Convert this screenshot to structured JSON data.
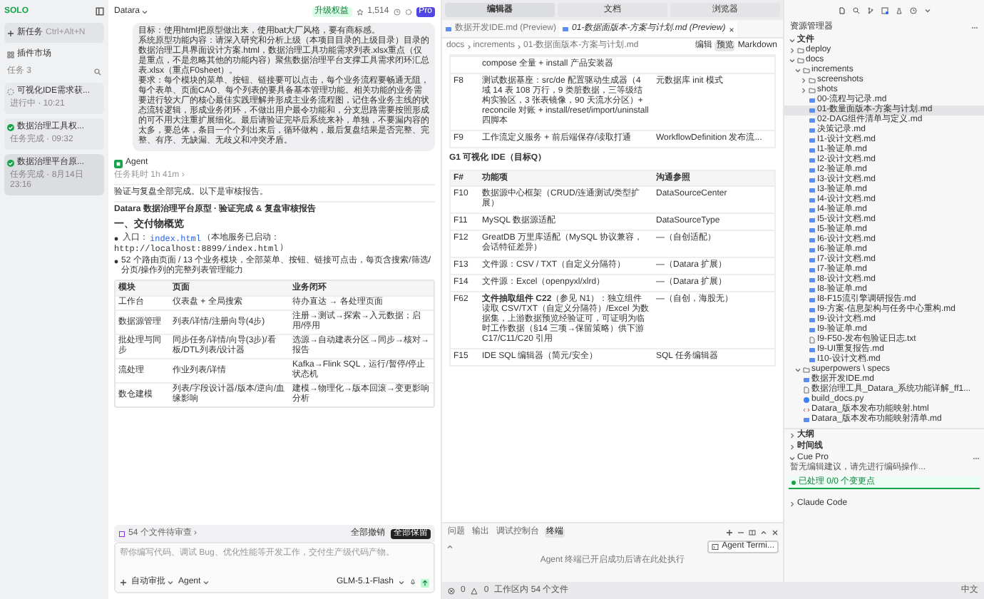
{
  "sidebar": {
    "logo": "SOLO",
    "new_task": {
      "label": "新任务",
      "shortcut": "Ctrl+Alt+N"
    },
    "plugin_market": "插件市场",
    "tasks_header": {
      "label": "任务",
      "count": "3"
    },
    "tasks": [
      {
        "title": "可视化IDE需求获...",
        "status": "进行中 · 10:21",
        "done": false,
        "selected": false
      },
      {
        "title": "数据治理工具权...",
        "status": "任务完成 · 09:32",
        "done": true,
        "selected": false
      },
      {
        "title": "数据治理平台原...",
        "status": "任务完成 · 8月14日 23:16",
        "done": true,
        "selected": true
      }
    ]
  },
  "chat": {
    "workspace": "Datara",
    "upgrade": "升级权益",
    "stars": "1,514",
    "plan": "Pro",
    "user_message": [
      "目标：使用html把原型做出来，使用bat大厂风格，要有商标感。",
      "系统原型功能内容：请深入研究和分析上级（本项目目录的上级目录）目录的数据治理工具界面设计方案.html，数据治理工具功能需求列表.xlsx重点（仅是重点，不是忽略其他的功能内容）聚焦数据治理平台支撑工具需求闭环汇总表.xlsx（重点F0sheet）。",
      "要求：每个模块的菜单、按钮、链接要可以点击，每个业务流程要畅通无阻，每个表单、页面CAO、每个列表的要具备基本管理功能。相关功能的业务需要进行较大厂的核心最佳实践理解并形成主业务流程图，记住各业务主线的状态流转逻辑，形成业务闭环，不做出用户最令功能和，分支思路需要按照形成的可不用大注重扩展细化。最后请验证完毕后系统来补，单独，不要漏内容的太多，要总体，条目一个个列出来后，循环做构，最后复盘结果是否完整、完整、有序、无缺漏、无歧义和冲突矛盾。"
    ],
    "agent": {
      "name": "Agent",
      "duration": "任务耗时 1h 41m ›",
      "intro": "验证与复盘全部完成。以下是审核报告。",
      "report_title": "Datara 数据治理平台原型 · 验证完成 & 复盘审核报告",
      "section": "一、交付物概览",
      "entry": {
        "label": "入口：",
        "code": "index.html",
        "note": "（本地服务已启动：",
        "url": "http://localhost:8899/index.html",
        "close": "）"
      },
      "summary": "52 个路由页面 / 13 个业务模块，全部菜单、按钮、链接可点击，每页含搜索/筛选/分页/操作列的完整列表管理能力",
      "table": {
        "columns": [
          "模块",
          "页面",
          "业务闭环"
        ],
        "rows": [
          [
            "工作台",
            "仪表盘 + 全局搜索",
            "待办直达 → 各处理页面"
          ],
          [
            "数据源管理",
            "列表/详情/注册向导(4步)",
            "注册→测试→探索→入元数据；启用/停用"
          ],
          [
            "批处理与同步",
            "同步任务/详情/向导(3步)/看板/DTL列表/设计器",
            "选源→自动建表分区→同步→核对→报告"
          ],
          [
            "流处理",
            "作业列表/详情",
            "Kafka→Flink SQL，运行/暂停/停止状态机"
          ],
          [
            "数仓建模",
            "列表/字段设计器/版本/逆向/血缘影响",
            "建模→物理化→版本回滚→变更影响分析"
          ]
        ]
      }
    },
    "review": {
      "label": "54 个文件待审查 ›",
      "reject": "全部撤销",
      "accept": "全部保留"
    },
    "composer": {
      "placeholder": "帮你编写代码、调试 Bug、优化性能等开发工作，交付生产级代码产物。",
      "approve": "自动审批",
      "mode": "Agent",
      "model": "GLM-5.1-Flash"
    }
  },
  "editor": {
    "top_tabs": [
      {
        "label": "编辑器",
        "selected": true
      },
      {
        "label": "文档",
        "selected": false
      },
      {
        "label": "浏览器",
        "selected": false
      }
    ],
    "file_tabs": [
      {
        "label": "数据开发IDE.md (Preview)",
        "selected": false
      },
      {
        "label": "01-数据面版本-方案与计划.md (Preview)",
        "selected": true
      }
    ],
    "breadcrumb": [
      "docs",
      "increments",
      "01-数据面版本-方案与计划.md"
    ],
    "view_buttons": [
      {
        "label": "编辑",
        "selected": false
      },
      {
        "label": "预览",
        "selected": true
      },
      {
        "label": "Markdown",
        "selected": false
      }
    ],
    "table1_rows": [
      [
        "",
        "compose 全量 + install 产品安装器",
        ""
      ],
      [
        "F8",
        "测试数据基座：src/de 配置驱动生成器（4 域 14 表 108 万行，9 类脏数据，三等级结构实验区，3 张表镜像，90 天流水分区）+ reconcile 对账 + install/reset/import/uninstall 四脚本",
        "元数据库 init 模式"
      ],
      [
        "F9",
        "工作流定义服务 + 前后端保存/读取打通",
        "WorkflowDefinition 发布流..."
      ]
    ],
    "heading": "G1 可视化 IDE（目标Q）",
    "table2": {
      "columns": [
        "F#",
        "功能项",
        "沟通参照"
      ],
      "rows": [
        [
          "F10",
          "数据源中心框架（CRUD/连通测试/类型扩展）",
          "DataSourceCenter"
        ],
        [
          "F11",
          "MySQL 数据源适配",
          "DataSourceType"
        ],
        [
          "F12",
          "GreatDB 万里库适配（MySQL 协议兼容，会话特征差异）",
          "—（自创适配）"
        ],
        [
          "F13",
          "文件源：CSV / TXT（自定义分隔符）",
          "—（Datara 扩展）"
        ],
        [
          "F14",
          "文件源：Excel（openpyxl/xlrd）",
          "—（Datara 扩展）"
        ],
        [
          "F62",
          "**文件抽取组件 C22**（参见 N1）：独立组件读取 CSV/TXT（自定义分隔符）/Excel 为数据集，上游数据预览经验证可，可证明为临时工作数据（§14 三项→保留策略）供下游 C17/C11/C20 引用",
          "—（自创，海股无）"
        ],
        [
          "F15",
          "IDE SQL 编辑器（简元/安全）",
          "SQL 任务编辑器"
        ]
      ]
    },
    "panel": {
      "tabs": [
        {
          "label": "问题",
          "selected": false
        },
        {
          "label": "输出",
          "selected": false
        },
        {
          "label": "调试控制台",
          "selected": false
        },
        {
          "label": "终端",
          "selected": true
        }
      ],
      "notice": "Agent 终端已开启成功后请在此处执行",
      "terminal_button": "Agent Termi..."
    }
  },
  "status_bar": {
    "errors": "0",
    "warnings": "0",
    "files": "工作区内 54 个文件",
    "language": "中文"
  },
  "explorer": {
    "title": "资源管理器",
    "section": "文件",
    "tree": [
      {
        "label": "deploy",
        "kind": "folder",
        "expanded": false,
        "selected": false
      },
      {
        "label": "docs",
        "kind": "folder",
        "expanded": true,
        "selected": false,
        "children": [
          {
            "label": "increments",
            "kind": "folder",
            "expanded": true,
            "selected": false,
            "children": [
              {
                "label": "screenshots",
                "kind": "folder",
                "expanded": false,
                "selected": false
              },
              {
                "label": "shots",
                "kind": "folder",
                "expanded": false,
                "selected": false
              },
              {
                "label": "00-流程与记录.md",
                "kind": "md",
                "selected": false
              },
              {
                "label": "01-数量面版本-方案与计划.md",
                "kind": "md",
                "selected": true
              },
              {
                "label": "02-DAG组件清单与定义.md",
                "kind": "md",
                "selected": false
              },
              {
                "label": "决策记录.md",
                "kind": "md",
                "selected": false
              },
              {
                "label": "I1-设计文档.md",
                "kind": "md",
                "selected": false
              },
              {
                "label": "I1-验证单.md",
                "kind": "md",
                "selected": false
              },
              {
                "label": "I2-设计文档.md",
                "kind": "md",
                "selected": false
              },
              {
                "label": "I2-验证单.md",
                "kind": "md",
                "selected": false
              },
              {
                "label": "I3-设计文档.md",
                "kind": "md",
                "selected": false
              },
              {
                "label": "I3-验证单.md",
                "kind": "md",
                "selected": false
              },
              {
                "label": "I4-设计文档.md",
                "kind": "md",
                "selected": false
              },
              {
                "label": "I4-验证单.md",
                "kind": "md",
                "selected": false
              },
              {
                "label": "I5-设计文档.md",
                "kind": "md",
                "selected": false
              },
              {
                "label": "I5-验证单.md",
                "kind": "md",
                "selected": false
              },
              {
                "label": "I6-设计文档.md",
                "kind": "md",
                "selected": false
              },
              {
                "label": "I6-验证单.md",
                "kind": "md",
                "selected": false
              },
              {
                "label": "I7-设计文档.md",
                "kind": "md",
                "selected": false
              },
              {
                "label": "I7-验证单.md",
                "kind": "md",
                "selected": false
              },
              {
                "label": "I8-设计文档.md",
                "kind": "md",
                "selected": false
              },
              {
                "label": "I8-验证单.md",
                "kind": "md",
                "selected": false
              },
              {
                "label": "I8-F15流引擎调研报告.md",
                "kind": "md",
                "selected": false
              },
              {
                "label": "I9-方案-信息架构与任务中心重构.md",
                "kind": "md",
                "selected": false
              },
              {
                "label": "I9-设计文档.md",
                "kind": "md",
                "selected": false
              },
              {
                "label": "I9-验证单.md",
                "kind": "md",
                "selected": false
              },
              {
                "label": "I9-F50-发布包验证日志.txt",
                "kind": "txt",
                "selected": false
              },
              {
                "label": "I9-UI重复报告.md",
                "kind": "md",
                "selected": false
              },
              {
                "label": "I10-设计文档.md",
                "kind": "md",
                "selected": false
              }
            ]
          },
          {
            "label": "superpowers \\ specs",
            "kind": "folder",
            "expanded": true,
            "selected": false
          },
          {
            "label": "数据开发IDE.md",
            "kind": "md",
            "selected": false
          },
          {
            "label": "数据治理工具_Datara_系统功能详解_ff1...",
            "kind": "txt",
            "selected": false
          },
          {
            "label": "build_docs.py",
            "kind": "py",
            "selected": false
          },
          {
            "label": "Datara_版本发布功能映射.html",
            "kind": "html",
            "selected": false
          },
          {
            "label": "Datara_版本发布功能映射清单.md",
            "kind": "md",
            "selected": false
          }
        ]
      }
    ],
    "sections": [
      {
        "label": "大纲",
        "expanded": false
      },
      {
        "label": "时间线",
        "expanded": false
      }
    ],
    "cue": {
      "label": "Cue Pro",
      "expanded": true,
      "message": "暂无编辑建议，请先进行编码操作...",
      "status": "已处理 0/0 个变更点"
    },
    "claude": {
      "label": "Claude Code",
      "expanded": false
    }
  }
}
